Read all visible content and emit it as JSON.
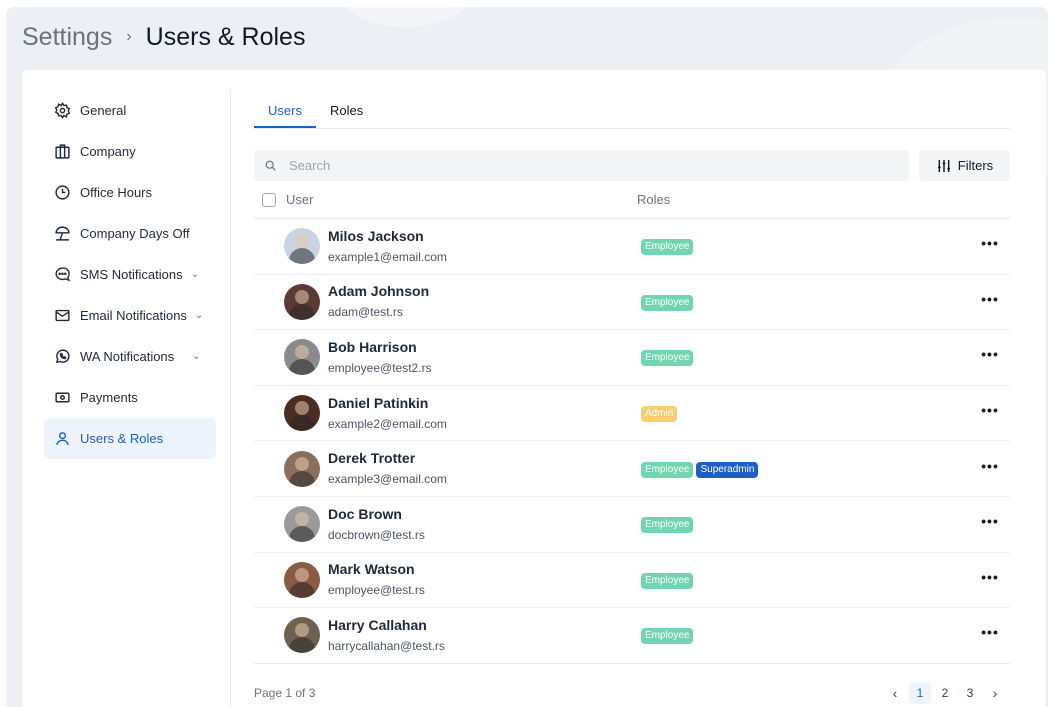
{
  "breadcrumb": {
    "root": "Settings",
    "separator": "›",
    "current": "Users & Roles"
  },
  "sidebar": {
    "items": [
      {
        "label": "General",
        "icon": "gear-icon",
        "chevron": ""
      },
      {
        "label": "Company",
        "icon": "building-icon",
        "chevron": ""
      },
      {
        "label": "Office Hours",
        "icon": "clock-icon",
        "chevron": ""
      },
      {
        "label": "Company Days Off",
        "icon": "beach-umbrella-icon",
        "chevron": ""
      },
      {
        "label": "SMS Notifications",
        "icon": "chat-bubble-icon",
        "chevron": "⌄"
      },
      {
        "label": "Email Notifications",
        "icon": "envelope-icon",
        "chevron": "⌄"
      },
      {
        "label": "WA Notifications",
        "icon": "whatsapp-icon",
        "chevron": "⌄"
      },
      {
        "label": "Payments",
        "icon": "cash-icon",
        "chevron": ""
      },
      {
        "label": "Users & Roles",
        "icon": "user-icon",
        "chevron": "",
        "active": true
      }
    ]
  },
  "tabs": [
    {
      "label": "Users",
      "active": true
    },
    {
      "label": "Roles",
      "active": false
    }
  ],
  "search": {
    "placeholder": "Search",
    "value": ""
  },
  "filters_label": "Filters",
  "table": {
    "headers": {
      "user": "User",
      "roles": "Roles"
    },
    "rows": [
      {
        "name": "Milos Jackson",
        "email": "example1@email.com",
        "roles": [
          "Employee"
        ],
        "avatar_color": "#c9d3e2"
      },
      {
        "name": "Adam Johnson",
        "email": "adam@test.rs",
        "roles": [
          "Employee"
        ],
        "avatar_color": "#5b3a36"
      },
      {
        "name": "Bob Harrison",
        "email": "employee@test2.rs",
        "roles": [
          "Employee"
        ],
        "avatar_color": "#8a8a8a"
      },
      {
        "name": "Daniel Patinkin",
        "email": "example2@email.com",
        "roles": [
          "Admin"
        ],
        "avatar_color": "#4a2e22"
      },
      {
        "name": "Derek Trotter",
        "email": "example3@email.com",
        "roles": [
          "Employee",
          "Superadmin"
        ],
        "avatar_color": "#8c6f5a"
      },
      {
        "name": "Doc Brown",
        "email": "docbrown@test.rs",
        "roles": [
          "Employee"
        ],
        "avatar_color": "#9a9a9a"
      },
      {
        "name": "Mark Watson",
        "email": "employee@test.rs",
        "roles": [
          "Employee"
        ],
        "avatar_color": "#8a5a42"
      },
      {
        "name": "Harry Callahan",
        "email": "harrycallahan@test.rs",
        "roles": [
          "Employee"
        ],
        "avatar_color": "#6d6250"
      }
    ],
    "row_action": "•••"
  },
  "pagination": {
    "summary": "Page 1 of 3",
    "pages": [
      "1",
      "2",
      "3"
    ],
    "current": "1",
    "prev": "‹",
    "next": "›"
  },
  "colors": {
    "accent": "#1d5fc4",
    "employee": "#6fd6b0",
    "admin": "#f6cf72",
    "superadmin": "#1d5fc4"
  }
}
